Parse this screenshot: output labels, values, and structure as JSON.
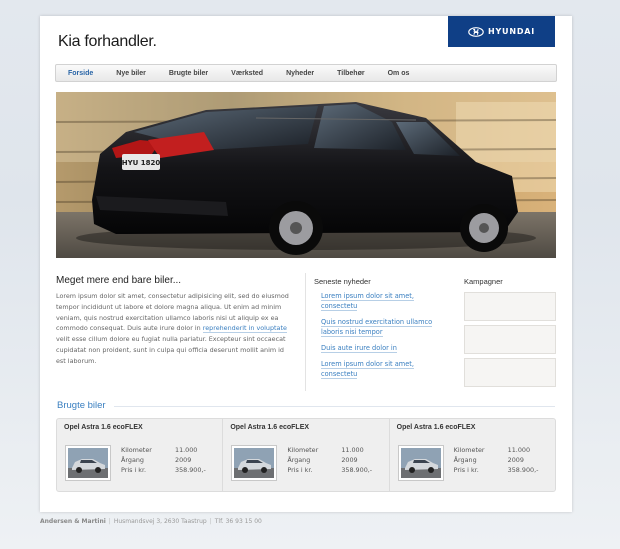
{
  "header": {
    "site_title": "Kia forhandler.",
    "brand": {
      "name": "HYUNDAI",
      "color": "#0f3f86",
      "icon": "hyundai-logo-icon"
    }
  },
  "nav": {
    "items": [
      {
        "label": "Forside",
        "active": true
      },
      {
        "label": "Nye biler"
      },
      {
        "label": "Brugte biler"
      },
      {
        "label": "Værksted"
      },
      {
        "label": "Nyheder"
      },
      {
        "label": "Tilbehør"
      },
      {
        "label": "Om os"
      }
    ]
  },
  "hero": {
    "plate": "HYU 1820",
    "icon": "suv-hero-image"
  },
  "intro": {
    "heading": "Meget mere end bare biler...",
    "text_before": "Lorem ipsum dolor sit amet, consectetur adipisicing elit, sed do eiusmod tempor incididunt ut labore et dolore magna aliqua. Ut enim ad minim veniam, quis nostrud exercitation ullamco laboris nisi ut aliquip ex ea commodo consequat. Duis aute irure dolor in ",
    "link": "reprehenderit in voluptate",
    "text_after": " velit esse cillum dolore eu fugiat nulla pariatur. Excepteur sint occaecat cupidatat non proident, sunt in culpa qui officia deserunt mollit anim id est laborum."
  },
  "news": {
    "title": "Seneste nyheder",
    "items": [
      "Lorem ipsum dolor sit amet, consectetu",
      "Quis nostrud exercitation ullamco laboris nisi tempor",
      "Duis aute irure dolor in",
      "Lorem ipsum dolor sit amet, consectetu"
    ]
  },
  "campaigns": {
    "title": "Kampagner",
    "box_count": 3
  },
  "used_cars": {
    "title": "Brugte biler",
    "cars": [
      {
        "name": "Opel Astra 1.6 ecoFLEX",
        "specs": [
          [
            "Kilometer",
            "11.000"
          ],
          [
            "Årgang",
            "2009"
          ],
          [
            "Pris i kr.",
            "358.900,-"
          ]
        ]
      },
      {
        "name": "Opel Astra 1.6 ecoFLEX",
        "specs": [
          [
            "Kilometer",
            "11.000"
          ],
          [
            "Årgang",
            "2009"
          ],
          [
            "Pris i kr.",
            "358.900,-"
          ]
        ]
      },
      {
        "name": "Opel Astra 1.6 ecoFLEX",
        "specs": [
          [
            "Kilometer",
            "11.000"
          ],
          [
            "Årgang",
            "2009"
          ],
          [
            "Pris i kr.",
            "358.900,-"
          ]
        ]
      }
    ],
    "thumb_icon": "car-thumbnail"
  },
  "footer": {
    "company": "Andersen & Martini",
    "address": "Husmandsvej 3, 2630 Taastrup",
    "phone": "Tlf. 36 93 15 00"
  },
  "colors": {
    "accent": "#3a7fc0",
    "brand": "#0f3f86"
  }
}
